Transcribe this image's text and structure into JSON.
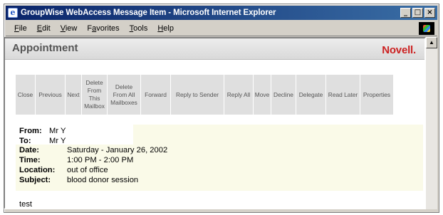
{
  "window": {
    "title": "GroupWise WebAccess Message Item - Microsoft Internet Explorer",
    "controls": [
      "_",
      "□",
      "×"
    ]
  },
  "menu": [
    {
      "pre": "",
      "key": "F",
      "post": "ile"
    },
    {
      "pre": "",
      "key": "E",
      "post": "dit"
    },
    {
      "pre": "",
      "key": "V",
      "post": "iew"
    },
    {
      "pre": "F",
      "key": "a",
      "post": "vorites"
    },
    {
      "pre": "",
      "key": "T",
      "post": "ools"
    },
    {
      "pre": "",
      "key": "H",
      "post": "elp"
    }
  ],
  "header": {
    "title": "Appointment",
    "brand": "Novell."
  },
  "toolbar": [
    {
      "label": "Close"
    },
    {
      "label": "Previous"
    },
    {
      "label": "Next"
    },
    {
      "label": "Delete From This Mailbox"
    },
    {
      "label": "Delete From All Mailboxes"
    },
    {
      "label": "Forward"
    },
    {
      "label": "Reply to Sender"
    },
    {
      "label": "Reply All"
    },
    {
      "label": "Move"
    },
    {
      "label": "Decline"
    },
    {
      "label": "Delegate"
    },
    {
      "label": "Read Later"
    },
    {
      "label": "Properties"
    }
  ],
  "details": {
    "from_label": "From:",
    "from": "Mr Y",
    "to_label": "To:",
    "to": "Mr Y",
    "date_label": "Date:",
    "date": "Saturday - January 26, 2002",
    "time_label": "Time:",
    "time": "1:00 PM - 2:00 PM",
    "location_label": "Location:",
    "location": "out of office",
    "subject_label": "Subject:",
    "subject": "blood donor session"
  },
  "body": "test",
  "colors": {
    "brand": "#cc2222",
    "titlebar_start": "#0a246a",
    "titlebar_end": "#3a6ea5",
    "detail_background": "#fafae8"
  }
}
